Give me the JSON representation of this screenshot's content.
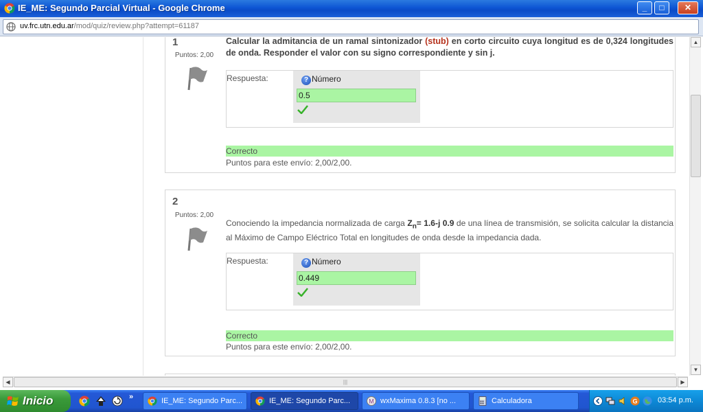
{
  "window": {
    "title": "IE_ME: Segundo Parcial Virtual - Google Chrome",
    "minimize": "_",
    "maximize": "□",
    "close": "✕"
  },
  "address": {
    "host": "uv.frc.utn.edu.ar",
    "path": "/mod/quiz/review.php?attempt=61187"
  },
  "questions": [
    {
      "number": "1",
      "points": "Puntos: 2,00",
      "text_before": "Calcular la admitancia de un ramal sintonizador ",
      "text_highlight": "(stub)",
      "text_after": " en corto circuito cuya longitud es de 0,324 longitudes de onda. Responder el valor con su signo correspondiente y sin j.",
      "answer_label": "Respuesta:",
      "number_label": "Número",
      "answer_value": "0.5",
      "status": "Correcto",
      "points_line": "Puntos para este envío: 2,00/2,00."
    },
    {
      "number": "2",
      "points": "Puntos: 2,00",
      "text_intro": "Conociendo la impedancia normalizada de carga ",
      "z_letter": "Z",
      "z_sub": "n",
      "z_value": "= 1.6-j 0.9",
      "text_after": " de una línea de transmisión, se solicita calcular la distancia al Máximo de Campo Eléctrico Total en longitudes de onda desde la impedancia dada.",
      "answer_label": "Respuesta:",
      "number_label": "Número",
      "answer_value": "0.449",
      "status": "Correcto",
      "points_line": "Puntos para este envío: 2,00/2,00."
    }
  ],
  "taskbar": {
    "start_label": "Inicio",
    "ql_more": "»",
    "tasks": [
      {
        "label": "IE_ME: Segundo Parc...",
        "icon": "chrome-icon",
        "active": false
      },
      {
        "label": "IE_ME: Segundo Parc...",
        "icon": "chrome-icon",
        "active": true
      },
      {
        "label": "wxMaxima 0.8.3 [no ...",
        "icon": "wxmaxima-icon",
        "active": false
      },
      {
        "label": "Calculadora",
        "icon": "calculator-icon",
        "active": false
      }
    ],
    "clock": "03:54 p.m."
  },
  "colors": {
    "correct_green": "#aaf5a3",
    "stub_red": "#b5311b",
    "xp_blue": "#2458d6"
  }
}
